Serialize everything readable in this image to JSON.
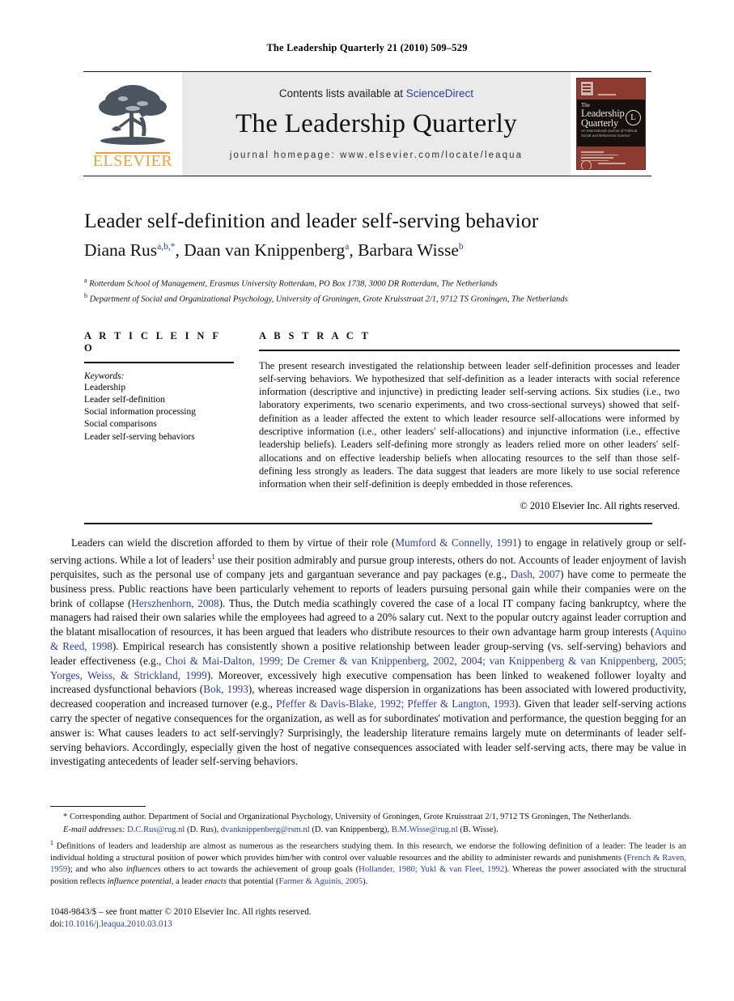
{
  "running_head": "The Leadership Quarterly 21 (2010) 509–529",
  "masthead": {
    "contents_prefix": "Contents lists available at",
    "sciencedirect": "ScienceDirect",
    "journal_name": "The Leadership Quarterly",
    "homepage": "journal homepage: www.elsevier.com/locate/leaqua",
    "publisher_wordmark": "ELSEVIER",
    "cover": {
      "the": "The",
      "leadership": "Leadership",
      "quarterly": "Quarterly",
      "subtitle": "An International Journal of Political,\nSocial and Behavioral Science",
      "monogram": "L"
    },
    "accent_gray": "#eaeaea",
    "link_blue": "#2b3f9e",
    "elsevier_orange": "#e8a33d",
    "cover_red": "#8d3a31"
  },
  "article": {
    "title": "Leader self-definition and leader self-serving behavior",
    "authors": [
      {
        "name": "Diana Rus",
        "sup": "a,b,*"
      },
      {
        "name": "Daan van Knippenberg",
        "sup": "a"
      },
      {
        "name": "Barbara Wisse",
        "sup": "b"
      }
    ],
    "affiliations": [
      {
        "mark": "a",
        "text": "Rotterdam School of Management, Erasmus University Rotterdam, PO Box 1738, 3000 DR Rotterdam, The Netherlands"
      },
      {
        "mark": "b",
        "text": "Department of Social and Organizational Psychology, University of Groningen, Grote Kruisstraat 2/1, 9712 TS Groningen, The Netherlands"
      }
    ]
  },
  "article_info": {
    "heading": "A R T I C L E   I N F O",
    "keywords_label": "Keywords:",
    "keywords": [
      "Leadership",
      "Leader self-definition",
      "Social information processing",
      "Social comparisons",
      "Leader self-serving behaviors"
    ]
  },
  "abstract": {
    "heading": "A B S T R A C T",
    "text": "The present research investigated the relationship between leader self-definition processes and leader self-serving behaviors. We hypothesized that self-definition as a leader interacts with social reference information (descriptive and injunctive) in predicting leader self-serving actions. Six studies (i.e., two laboratory experiments, two scenario experiments, and two cross-sectional surveys) showed that self-definition as a leader affected the extent to which leader resource self-allocations were informed by descriptive information (i.e., other leaders' self-allocations) and injunctive information (i.e., effective leadership beliefs). Leaders self-defining more strongly as leaders relied more on other leaders' self-allocations and on effective leadership beliefs when allocating resources to the self than those self-defining less strongly as leaders. The data suggest that leaders are more likely to use social reference information when their self-definition is deeply embedded in those references.",
    "copyright": "© 2010 Elsevier Inc. All rights reserved."
  },
  "body": {
    "seg_1": "Leaders can wield the discretion afforded to them by virtue of their role (",
    "cite_1": "Mumford & Connelly, 1991",
    "seg_2": ") to engage in relatively group or self-serving actions. While a lot of leaders",
    "fn_marker_1": "1",
    "seg_3": " use their position admirably and pursue group interests, others do not. Accounts of leader enjoyment of lavish perquisites, such as the personal use of company jets and gargantuan severance and pay packages (e.g., ",
    "cite_2": "Dash, 2007",
    "seg_4": ") have come to permeate the business press. Public reactions have been particularly vehement to reports of leaders pursuing personal gain while their companies were on the brink of collapse (",
    "cite_3": "Herszhenhorn, 2008",
    "seg_5": "). Thus, the Dutch media scathingly covered the case of a local IT company facing bankruptcy, where the managers had raised their own salaries while the employees had agreed to a 20% salary cut. Next to the popular outcry against leader corruption and the blatant misallocation of resources, it has been argued that leaders who distribute resources to their own advantage harm group interests (",
    "cite_4": "Aquino & Reed, 1998",
    "seg_6": "). Empirical research has consistently shown a positive relationship between leader group-serving (vs. self-serving) behaviors and leader effectiveness (e.g., ",
    "cite_5": "Choi & Mai-Dalton, 1999; De Cremer & van Knippenberg, 2002, 2004; van Knippenberg & van Knippenberg, 2005; Yorges, Weiss, & Strickland, 1999",
    "seg_7": "). Moreover, excessively high executive compensation has been linked to weakened follower loyalty and increased dysfunctional behaviors (",
    "cite_6": "Bok, 1993",
    "seg_8": "), whereas increased wage dispersion in organizations has been associated with lowered productivity, decreased cooperation and increased turnover (e.g., ",
    "cite_7": "Pfeffer & Davis-Blake, 1992; Pfeffer & Langton, 1993",
    "seg_9": "). Given that leader self-serving actions carry the specter of negative consequences for the organization, as well as for subordinates' motivation and performance, the question begging for an answer is: What causes leaders to act self-servingly? Surprisingly, the leadership literature remains largely mute on determinants of leader self-serving behaviors. Accordingly, especially given the host of negative consequences associated with leader self-serving acts, there may be value in investigating antecedents of leader self-serving behaviors."
  },
  "footnotes": {
    "corresponding_marker": "*",
    "corresponding": " Corresponding author. Department of Social and Organizational Psychology, University of Groningen, Grote Kruisstraat 2/1, 9712 TS Groningen, The Netherlands.",
    "email_label": "E-mail addresses:",
    "emails": [
      {
        "address": "D.C.Rus@rug.nl",
        "who": "(D. Rus)"
      },
      {
        "address": "dvanknippenberg@rsm.nl",
        "who": "(D. van Knippenberg)"
      },
      {
        "address": "B.M.Wisse@rug.nl",
        "who": "(B. Wisse)"
      }
    ],
    "note1_marker": "1",
    "note1_a": " Definitions of leaders and leadership are almost as numerous as the researchers studying them. In this research, we endorse the following definition of a leader: The leader is an individual holding a structural position of power which provides him/her with control over valuable resources and the ability to administer rewards and punishments (",
    "note1_cite1": "French & Raven, 1959",
    "note1_b": "); and who also ",
    "note1_em1": "influences",
    "note1_c": " others to act towards the achievement of group goals (",
    "note1_cite2": "Hollander, 1980; Yukl & van Fleet, 1992",
    "note1_d": "). Whereas the power associated with the structural position reflects ",
    "note1_em2": "influence potential",
    "note1_e": ", a leader ",
    "note1_em3": "enacts",
    "note1_f": " that potential (",
    "note1_cite3": "Farmer & Aguinis, 2005",
    "note1_g": ")."
  },
  "imprint": {
    "line1": "1048-9843/$ – see front matter © 2010 Elsevier Inc. All rights reserved.",
    "doi_label": "doi:",
    "doi_value": "10.1016/j.leaqua.2010.03.013"
  }
}
